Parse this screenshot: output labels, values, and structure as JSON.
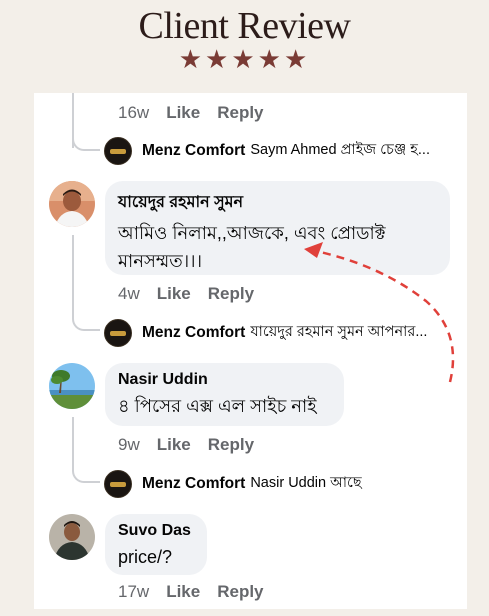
{
  "header": {
    "title": "Client Review",
    "stars": "★★★★★"
  },
  "thread": {
    "top_meta": {
      "time": "16w",
      "like": "Like",
      "reply": "Reply"
    },
    "reply1": {
      "name": "Menz Comfort",
      "text": "Saym Ahmed প্রাইজ চেঞ্জ হ..."
    },
    "comment1": {
      "name": "যায়েদুর রহমান সুমন",
      "line1": "আমিও নিলাম,,আজকে, এবং প্রোডাক্ট",
      "line2": "মানসম্মত।।।",
      "time": "4w",
      "like": "Like",
      "reply": "Reply"
    },
    "reply2": {
      "name": "Menz Comfort",
      "text": "যায়েদুর রহমান সুমন আপনার..."
    },
    "comment2": {
      "name": "Nasir Uddin",
      "text": "৪ পিসের এক্স এল সাইচ নাই",
      "time": "9w",
      "like": "Like",
      "reply": "Reply"
    },
    "reply3": {
      "name": "Menz Comfort",
      "text": "Nasir Uddin আছে"
    },
    "comment3": {
      "name": "Suvo Das",
      "text": "price/?",
      "time": "17w",
      "like": "Like",
      "reply": "Reply"
    }
  },
  "colors": {
    "star": "#7a3b35",
    "arrow": "#e0403a",
    "bubble": "#f0f2f5",
    "meta": "#65676b"
  },
  "icons": [
    "brand-avatar-icon",
    "star-icon",
    "dashed-arrow"
  ]
}
